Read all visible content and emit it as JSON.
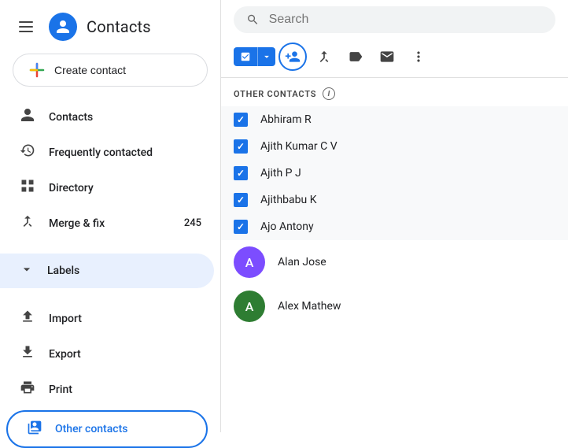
{
  "app": {
    "title": "Contacts",
    "logo_letter": "👤"
  },
  "sidebar": {
    "create_contact_label": "Create contact",
    "nav_items": [
      {
        "id": "contacts",
        "label": "Contacts",
        "icon": "person"
      },
      {
        "id": "frequently-contacted",
        "label": "Frequently contacted",
        "icon": "history"
      },
      {
        "id": "directory",
        "label": "Directory",
        "icon": "grid"
      },
      {
        "id": "merge-fix",
        "label": "Merge & fix",
        "icon": "merge",
        "badge": "245"
      }
    ],
    "labels_label": "Labels",
    "import_label": "Import",
    "export_label": "Export",
    "print_label": "Print",
    "other_contacts_label": "Other contacts"
  },
  "search": {
    "placeholder": "Search"
  },
  "toolbar": {
    "add_to_contacts_title": "Add to contacts",
    "merge_title": "Merge",
    "label_title": "Label",
    "email_title": "Email",
    "more_title": "More"
  },
  "section": {
    "title": "OTHER CONTACTS"
  },
  "contacts": [
    {
      "id": 1,
      "name": "Abhiram R",
      "checked": true,
      "avatar_color": null
    },
    {
      "id": 2,
      "name": "Ajith Kumar C V",
      "checked": true,
      "avatar_color": null
    },
    {
      "id": 3,
      "name": "Ajith P J",
      "checked": true,
      "avatar_color": null
    },
    {
      "id": 4,
      "name": "Ajithbabu K",
      "checked": true,
      "avatar_color": null
    },
    {
      "id": 5,
      "name": "Ajo Antony",
      "checked": true,
      "avatar_color": null
    },
    {
      "id": 6,
      "name": "Alan Jose",
      "checked": false,
      "avatar_color": "#7c4dff",
      "avatar_letter": "A"
    },
    {
      "id": 7,
      "name": "Alex Mathew",
      "checked": false,
      "avatar_color": "#2e7d32",
      "avatar_letter": "A"
    }
  ]
}
